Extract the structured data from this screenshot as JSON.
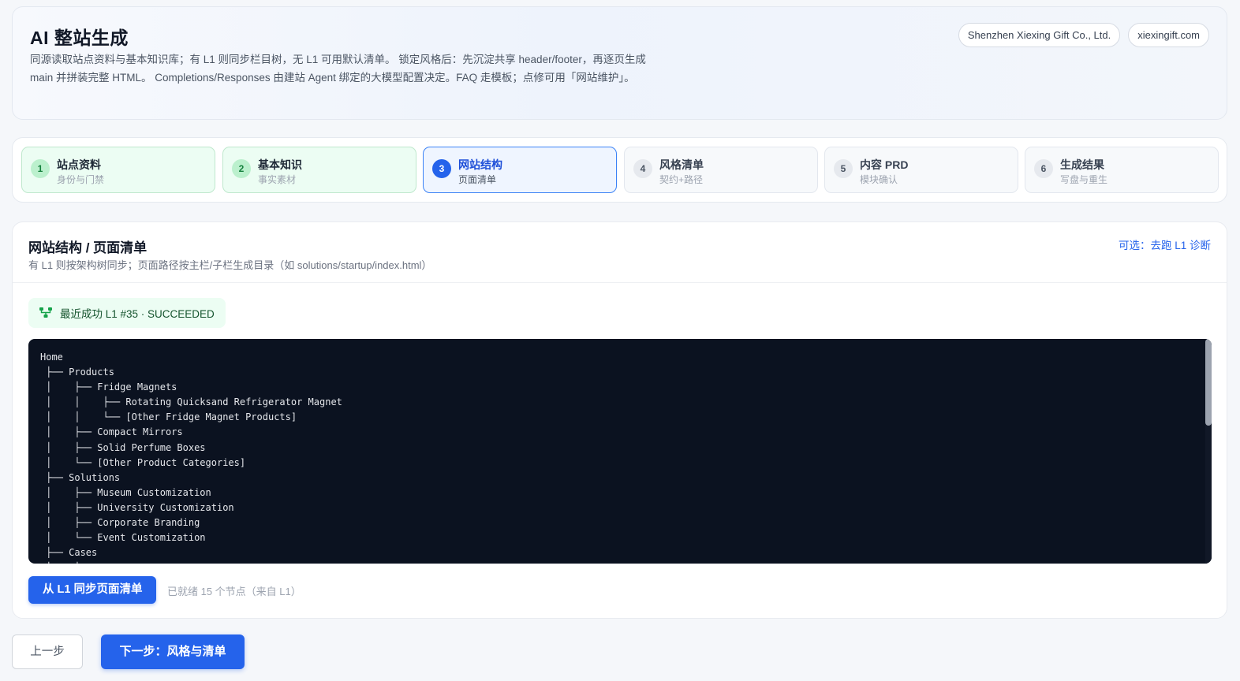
{
  "header": {
    "title": "AI 整站生成",
    "description": "同源读取站点资料与基本知识库；有 L1 则同步栏目树，无 L1 可用默认清单。 锁定风格后：先沉淀共享 header/footer，再逐页生成 main 并拼装完整 HTML。 Completions/Responses 由建站 Agent 绑定的大模型配置决定。FAQ 走模板；点修可用「网站维护」。",
    "company_chip": "Shenzhen Xiexing Gift Co., Ltd.",
    "domain_chip": "xiexingift.com"
  },
  "steps": [
    {
      "num": "1",
      "title": "站点资料",
      "sub": "身份与门禁",
      "state": "done"
    },
    {
      "num": "2",
      "title": "基本知识",
      "sub": "事实素材",
      "state": "done"
    },
    {
      "num": "3",
      "title": "网站结构",
      "sub": "页面清单",
      "state": "active"
    },
    {
      "num": "4",
      "title": "风格清单",
      "sub": "契约+路径",
      "state": "pending"
    },
    {
      "num": "5",
      "title": "内容 PRD",
      "sub": "模块确认",
      "state": "pending"
    },
    {
      "num": "6",
      "title": "生成结果",
      "sub": "写盘与重生",
      "state": "pending"
    }
  ],
  "panel": {
    "title": "网站结构 / 页面清单",
    "subtitle": "有 L1 则按架构树同步；页面路径按主栏/子栏生成目录（如 solutions/startup/index.html）",
    "link": "可选：去跑 L1 诊断",
    "status": "最近成功 L1 #35 · SUCCEEDED",
    "tree_lines": [
      "Home",
      " ├── Products",
      " │    ├── Fridge Magnets",
      " │    │    ├── Rotating Quicksand Refrigerator Magnet",
      " │    │    └── [Other Fridge Magnet Products]",
      " │    ├── Compact Mirrors",
      " │    ├── Solid Perfume Boxes",
      " │    └── [Other Product Categories]",
      " ├── Solutions",
      " │    ├── Museum Customization",
      " │    ├── University Customization",
      " │    ├── Corporate Branding",
      " │    └── Event Customization",
      " ├── Cases",
      " │    ├──"
    ],
    "sync_button": "从 L1 同步页面清单",
    "sync_note": "已就绪 15 个节点（来自 L1）"
  },
  "footer": {
    "prev_label": "上一步",
    "next_label": "下一步：风格与清单"
  },
  "colors": {
    "primary": "#2563eb",
    "success_bg": "#ecfdf3",
    "terminal_bg": "#0b1220"
  },
  "icons": {
    "status": "sitemap-icon"
  }
}
